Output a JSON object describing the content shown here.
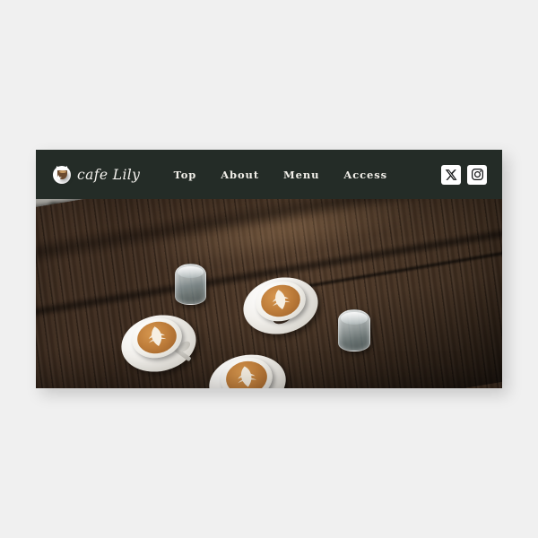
{
  "page": {
    "background_color": "#f0f0f0"
  },
  "site_card": {
    "header": {
      "background_color": "#242c27",
      "brand": {
        "name": "cafe Lily",
        "mark_icon": "cat-coffee-cup-icon"
      },
      "nav": {
        "items": [
          {
            "label": "Top"
          },
          {
            "label": "About"
          },
          {
            "label": "Menu"
          },
          {
            "label": "Access"
          }
        ]
      },
      "social": {
        "items": [
          {
            "name": "x-twitter-icon",
            "label": "X"
          },
          {
            "name": "instagram-icon",
            "label": "Instagram"
          }
        ]
      }
    },
    "hero": {
      "alt": "Three latte art coffee cups and glasses of water on a dark rustic wooden table beside a deep green bench",
      "colors": {
        "wood": "#3e2c1f",
        "green": "#0e4936",
        "floor": "#bcbab3",
        "crema": "#c07f3c"
      }
    }
  }
}
